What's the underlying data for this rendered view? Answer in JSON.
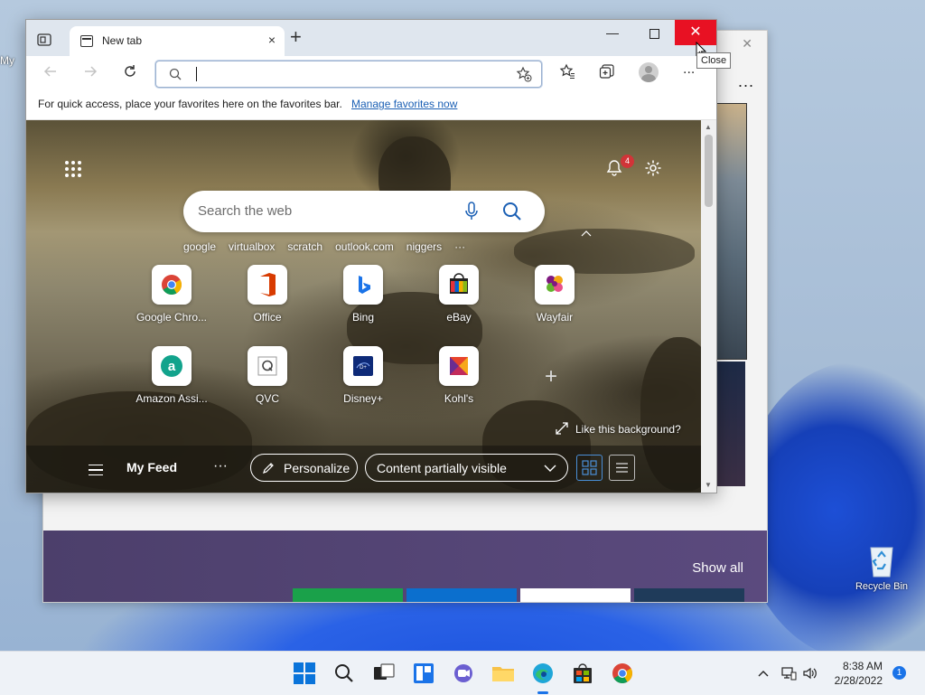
{
  "desktop": {
    "partial_label": "My",
    "recycle_bin_label": "Recycle Bin"
  },
  "background_window": {
    "more_label": "...",
    "show_all": "Show all"
  },
  "edge": {
    "tab_title": "New tab",
    "tab_close": "×",
    "new_tab": "+",
    "address_value": "",
    "favorites_bar_text": "For quick access, place your favorites here on the favorites bar.",
    "favorites_bar_link": "Manage favorites now",
    "more_label": "...",
    "tooltip": "Close"
  },
  "ntp": {
    "notification_count": "4",
    "search_placeholder": "Search the web",
    "quick_links": [
      "google",
      "virtualbox",
      "scratch",
      "outlook.com",
      "niggers",
      "···"
    ],
    "tiles": [
      {
        "label": "Google Chro...",
        "icon": "chrome-icon"
      },
      {
        "label": "Office",
        "icon": "office-icon"
      },
      {
        "label": "Bing",
        "icon": "bing-icon"
      },
      {
        "label": "eBay",
        "icon": "ebay-icon"
      },
      {
        "label": "Wayfair",
        "icon": "wayfair-icon"
      },
      {
        "label": "Amazon Assi...",
        "icon": "amazon-assistant-icon"
      },
      {
        "label": "QVC",
        "icon": "qvc-icon"
      },
      {
        "label": "Disney+",
        "icon": "disney-plus-icon"
      },
      {
        "label": "Kohl's",
        "icon": "kohls-icon"
      }
    ],
    "add_tile": "+",
    "like_background": "Like this background?",
    "feed": {
      "title": "My Feed",
      "more": "···",
      "personalize": "Personalize",
      "content_visibility": "Content partially visible"
    }
  },
  "taskbar": {
    "time": "8:38 AM",
    "date": "2/28/2022",
    "notification_count": "1"
  },
  "colors": {
    "close_red": "#e81123",
    "link_blue": "#1a5fb4",
    "badge_red": "#d13438",
    "accent_blue": "#1a73e8"
  }
}
